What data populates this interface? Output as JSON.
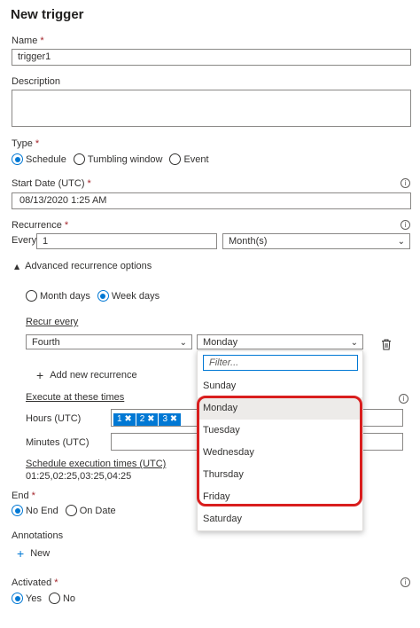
{
  "header": {
    "title": "New trigger"
  },
  "name": {
    "label": "Name",
    "required": "*",
    "value": "trigger1"
  },
  "description": {
    "label": "Description",
    "value": ""
  },
  "type": {
    "label": "Type",
    "required": "*",
    "options": [
      "Schedule",
      "Tumbling window",
      "Event"
    ],
    "selected": "Schedule"
  },
  "start_date": {
    "label": "Start Date (UTC)",
    "required": "*",
    "value": "08/13/2020 1:25 AM"
  },
  "recurrence": {
    "label": "Recurrence",
    "required": "*",
    "every_label": "Every",
    "every_value": "1",
    "unit": "Month(s)"
  },
  "advanced": {
    "toggle_label": "Advanced recurrence options",
    "mode_options": [
      "Month days",
      "Week days"
    ],
    "mode_selected": "Week days",
    "recur_every_label": "Recur every",
    "ordinal": "Fourth",
    "weekday": "Monday",
    "add_label": "Add new recurrence",
    "exec_label": "Execute at these times",
    "hours_label": "Hours (UTC)",
    "hours_tags": [
      "1",
      "2",
      "3"
    ],
    "minutes_label": "Minutes (UTC)",
    "sched_link": "Schedule execution times (UTC)",
    "sched_times": "01:25,02:25,03:25,04:25"
  },
  "dropdown": {
    "filter_placeholder": "Filter...",
    "items": [
      "Sunday",
      "Monday",
      "Tuesday",
      "Wednesday",
      "Thursday",
      "Friday",
      "Saturday"
    ],
    "highlighted": "Monday"
  },
  "end": {
    "label": "End",
    "required": "*",
    "options": [
      "No End",
      "On Date"
    ],
    "selected": "No End"
  },
  "annotations": {
    "label": "Annotations",
    "new_label": "New"
  },
  "activated": {
    "label": "Activated",
    "required": "*",
    "options": [
      "Yes",
      "No"
    ],
    "selected": "Yes"
  },
  "colors": {
    "accent": "#0078d4",
    "highlight_border": "#d91e1e"
  },
  "icons": {
    "info": "info-icon",
    "delete": "trash-icon",
    "add": "plus-icon",
    "expand": "caret-down-icon",
    "chevron": "chevron-down-icon"
  }
}
